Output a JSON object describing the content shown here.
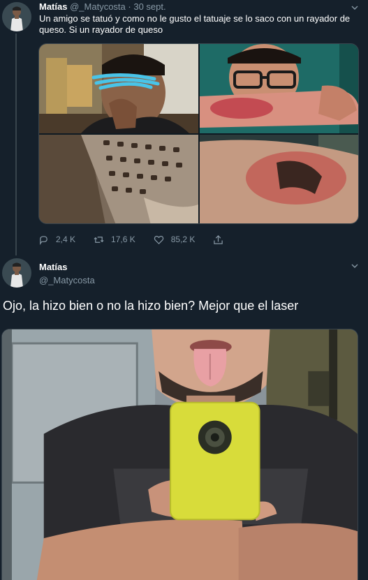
{
  "tweet1": {
    "author_name": "Matías",
    "author_handle": "@_Matycosta",
    "separator": "·",
    "date": "30 sept.",
    "text": "Un amigo se tatuó y como no le gusto el tatuaje se lo saco con un rayador de queso. Si un rayador de queso",
    "images": [
      {
        "icon": "photo-selfie-face-censored"
      },
      {
        "icon": "photo-arm-wound-glasses"
      },
      {
        "icon": "photo-cheese-grater"
      },
      {
        "icon": "photo-arm-scraped-tattoo"
      }
    ],
    "actions": {
      "reply_icon": "reply-icon",
      "replies": "2,4 K",
      "retweet_icon": "retweet-icon",
      "retweets": "17,6 K",
      "like_icon": "heart-icon",
      "likes": "85,2 K",
      "share_icon": "share-icon"
    }
  },
  "tweet2": {
    "author_name": "Matías",
    "author_handle": "@_Matycosta",
    "text": "Ojo, la hizo bien o no la hizo bien? Mejor que el laser",
    "image": {
      "icon": "photo-mirror-selfie-tongue"
    }
  },
  "colors": {
    "background": "#15202b",
    "muted": "#8899a6",
    "border": "#38444d",
    "text": "#ffffff"
  }
}
